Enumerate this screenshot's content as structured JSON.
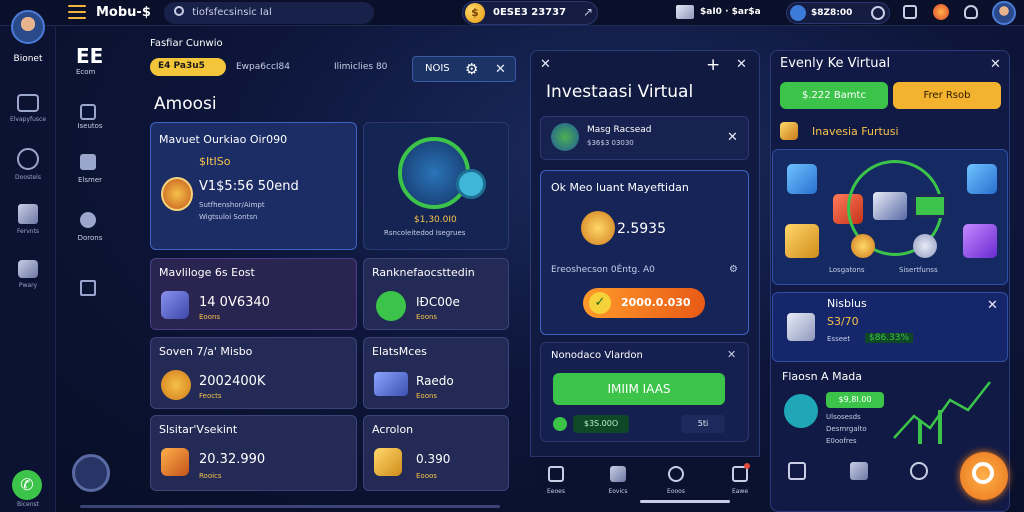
{
  "topbar": {
    "brand": "Mobu-$",
    "search_text": "tiofsfecsinsic Ial",
    "coin_symbol": "$",
    "balance": "0ESE3 23737",
    "pill2_text": "$aI0 · $ar$a",
    "pill3_text": "$8Z8:00"
  },
  "sidebar": {
    "user_label": "Bionet",
    "items": [
      {
        "label": "Elvapyfusce",
        "icon": "image-icon"
      },
      {
        "label": "Doostels",
        "icon": "globe-icon"
      },
      {
        "label": "Fervnts",
        "icon": "cube-icon"
      },
      {
        "label": "Pwary",
        "icon": "boxes-icon"
      }
    ],
    "bottom_label": "Bicenst"
  },
  "secondary_nav": {
    "logo": "EE",
    "logo_sub": "Ecom",
    "items": [
      "Iseutos",
      "Elsmer",
      "Dorons"
    ]
  },
  "panel1": {
    "header": "Fasfiar Cunwio",
    "chip_left": "E4 Pa3u5",
    "chip_mid": "Ewpa6ccI84",
    "chip_right": "Ilimiclies 80",
    "tag_label": "NOIS",
    "title": "Amoosi",
    "hero": {
      "title": "Mavuet Ourkiao Oir090",
      "price": "$ItISo",
      "value": "V1$5:56 50end",
      "line1": "Sutfhenshor/Aimpt",
      "line2": "Wigtsuloi Sontsn"
    },
    "hero_right": {
      "value": "$1,30.0I0",
      "caption": "Rsncoleitedod Isegrues"
    },
    "cards": [
      {
        "title": "Mavliloge 6s Eost",
        "value": "14 0V6340",
        "sub": "Eoons"
      },
      {
        "title": "Ranknefaocsttedin",
        "value": "IÐC00e",
        "sub": "Eoons"
      },
      {
        "title": "Soven 7/a' Misbo",
        "value": "2002400K",
        "sub": "Feocts"
      },
      {
        "title": "ElatsMces",
        "value": "Raedo",
        "sub": "Eoons"
      },
      {
        "title": "Slsitar'Vsekint",
        "value": "20.32.990",
        "sub": "Rooics"
      },
      {
        "title": "Acrolon",
        "value": "0.390",
        "sub": "Eooos"
      }
    ]
  },
  "panel2": {
    "title": "Investaasi Virtual",
    "search_title": "Masg Racsead",
    "search_sub": "$36$3 03030",
    "main_title": "Ok Meo luant Mayeftidan",
    "main_value": "2.5935",
    "main_sub": "Ereoshecson 0Èntg. A0",
    "cta_value": "2000.0.030",
    "section_title": "Nonodaco Vlardon",
    "green_btn": "IMIIM IAAS",
    "footer_left": "$3S.00O",
    "footer_right": "5ti",
    "nav": [
      "Eeoes",
      "Eovics",
      "Eooos",
      "Eawe"
    ]
  },
  "panel3": {
    "title": "Evenly Ke Virtual",
    "btn_green": "$.222 Bamtc",
    "btn_yellow": "Frer Rsob",
    "subtitle": "Inavesia Furtusi",
    "hero_lbl1": "Losgatons",
    "hero_lbl2": "Sisertfunss",
    "card": {
      "title": "Nisblus",
      "value": "S3/70",
      "sub1": "Esseet",
      "sub2": "$86.33%"
    },
    "trend_title": "Flaosn A Mada",
    "trend_value": "$9,8I.00",
    "trend_sub1": "Ulsosesds",
    "trend_sub2": "Desmrgalto",
    "trend_sub3": "E0oofres"
  },
  "colors": {
    "accent_green": "#3cc44a",
    "accent_yellow": "#f3b32e",
    "bg": "#0b1330"
  }
}
